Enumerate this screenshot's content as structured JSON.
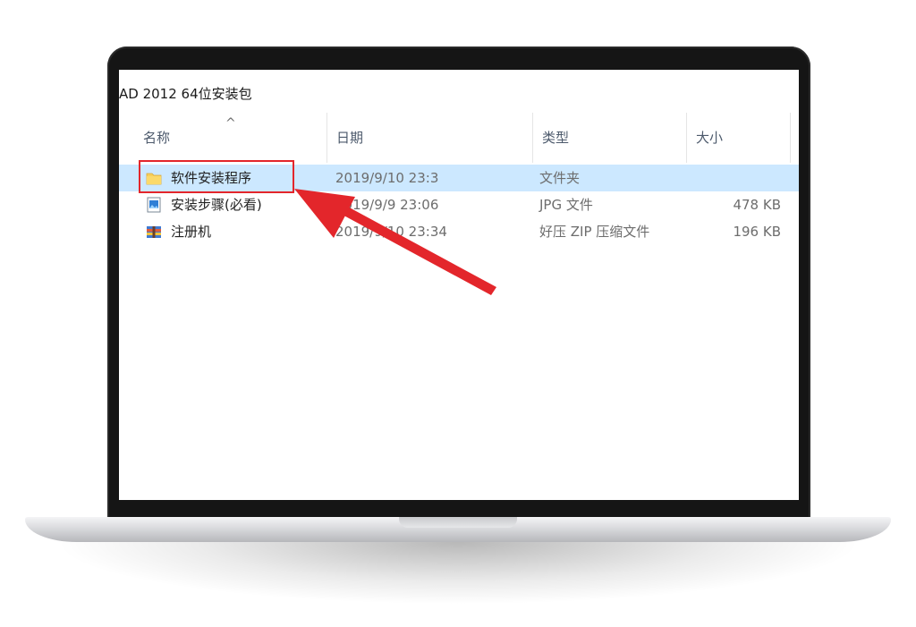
{
  "window": {
    "title": "AD 2012 64位安装包"
  },
  "columns": {
    "name": "名称",
    "date": "日期",
    "type": "类型",
    "size": "大小"
  },
  "sort_indicator": "^",
  "files": [
    {
      "name": "软件安装程序",
      "date": "2019/9/10 23:3",
      "type": "文件夹",
      "size": "",
      "icon": "folder-icon"
    },
    {
      "name": "安装步骤(必看)",
      "date": "2019/9/9 23:06",
      "type": "JPG 文件",
      "size": "478 KB",
      "icon": "image-file-icon"
    },
    {
      "name": "注册机",
      "date": "2019/9/10 23:34",
      "type": "好压 ZIP 压缩文件",
      "size": "196 KB",
      "icon": "zip-archive-icon"
    }
  ],
  "colors": {
    "selection": "#cce8ff",
    "highlight_box": "#e3262b",
    "annotation_arrow": "#e3262b",
    "folder": "#f7cf5a"
  }
}
